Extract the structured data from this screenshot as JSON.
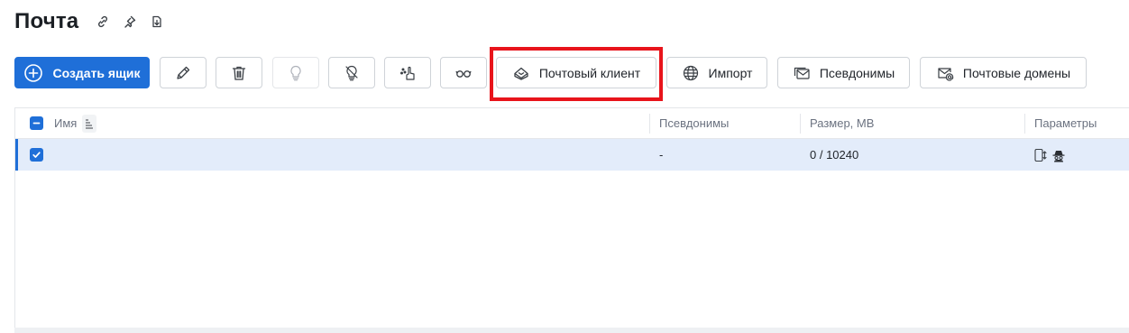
{
  "header": {
    "title": "Почта",
    "icons": [
      "link-icon",
      "pin-icon",
      "export-icon"
    ]
  },
  "toolbar": {
    "create_label": "Создать ящик",
    "icon_buttons": [
      "edit-icon",
      "trash-icon",
      "lightbulb-icon",
      "lightbulb-off-icon",
      "hand-pointer-icon",
      "glasses-icon"
    ],
    "mail_client_label": "Почтовый клиент",
    "import_label": "Импорт",
    "aliases_label": "Псевдонимы",
    "mail_domains_label": "Почтовые домены"
  },
  "table": {
    "columns": [
      "Имя",
      "Псевдонимы",
      "Размер, MB",
      "Параметры"
    ],
    "rows": [
      {
        "selected": true,
        "name": "",
        "aliases": "-",
        "size": "0 / 10240",
        "params_icons": [
          "mobile-sync-icon",
          "spy-icon"
        ]
      }
    ]
  },
  "colors": {
    "accent": "#1f6fd8",
    "selected_row": "#e3ecfa",
    "highlight": "#e8141b"
  }
}
